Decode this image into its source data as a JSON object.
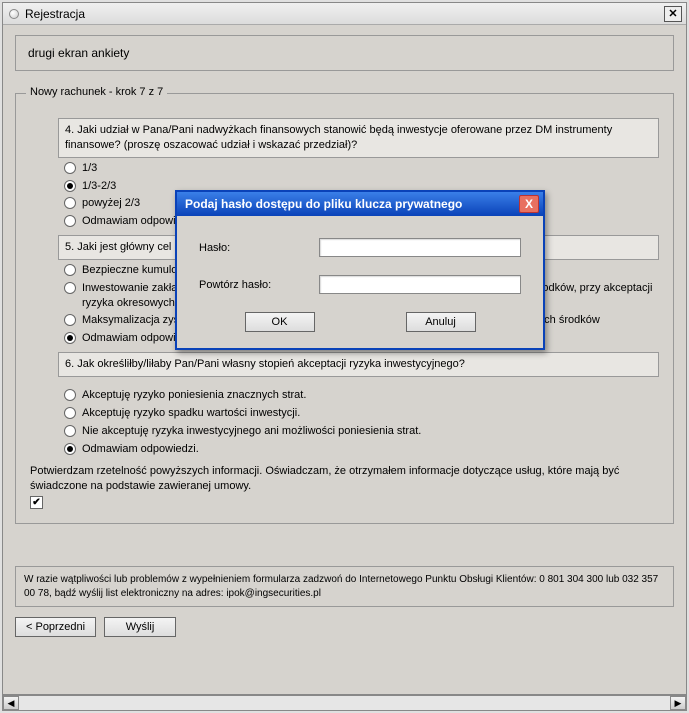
{
  "window": {
    "title": "Rejestracja",
    "close_glyph": "✕"
  },
  "header_text": "drugi ekran ankiety",
  "group_title": "Nowy rachunek - krok 7 z 7",
  "q4": {
    "text": "4. Jaki udział w Pana/Pani nadwyżkach finansowych stanowić będą inwestycje oferowane przez DM instrumenty finansowe? (proszę oszacować udział i wskazać przedział)?",
    "opts": [
      "1/3",
      "1/3-2/3",
      "powyżej 2/3",
      "Odmawiam odpowiedzi"
    ],
    "selected": 1
  },
  "q5": {
    "text": "5. Jaki jest główny cel Pana/Pani inwestycji?",
    "opts": [
      "Bezpieczne kumulowanie środków",
      "Inwestowanie zakładające osiągnięcie w długim terminie wzrostu wartości zainwestowanych środków, przy akceptacji ryzyka okresowych strat",
      "Maksymalizacja zysku przy akceptacji ryzyka utraty znacznej części lub całości zainwestowanych środków",
      "Odmawiam odpowiedzi."
    ],
    "selected": 3
  },
  "q6": {
    "text": "6. Jak określiłby/liłaby Pan/Pani własny stopień akceptacji ryzyka inwestycyjnego?",
    "opts": [
      "Akceptuję ryzyko poniesienia znacznych strat.",
      "Akceptuję ryzyko spadku wartości inwestycji.",
      "Nie akceptuję ryzyka inwestycyjnego ani możliwości poniesienia strat.",
      "Odmawiam odpowiedzi."
    ],
    "selected": 3
  },
  "confirmation_text": "Potwierdzam rzetelność powyższych informacji. Oświadczam, że otrzymałem informacje dotyczące usług, które mają być świadczone na podstawie zawieranej umowy.",
  "confirmation_checked": true,
  "help_text": "W razie wątpliwości lub problemów z wypełnieniem formularza zadzwoń do Internetowego Punktu Obsługi Klientów: 0 801 304 300 lub 032 357 00 78, bądź wyślij list elektroniczny na adres: ipok@ingsecurities.pl",
  "buttons": {
    "prev": "< Poprzedni",
    "send": "Wyślij"
  },
  "dialog": {
    "title": "Podaj hasło dostępu do pliku klucza prywatnego",
    "close_glyph": "X",
    "password_label": "Hasło:",
    "repeat_label": "Powtórz hasło:",
    "ok": "OK",
    "cancel": "Anuluj"
  },
  "scroll": {
    "left_glyph": "◀",
    "right_glyph": "▶"
  }
}
